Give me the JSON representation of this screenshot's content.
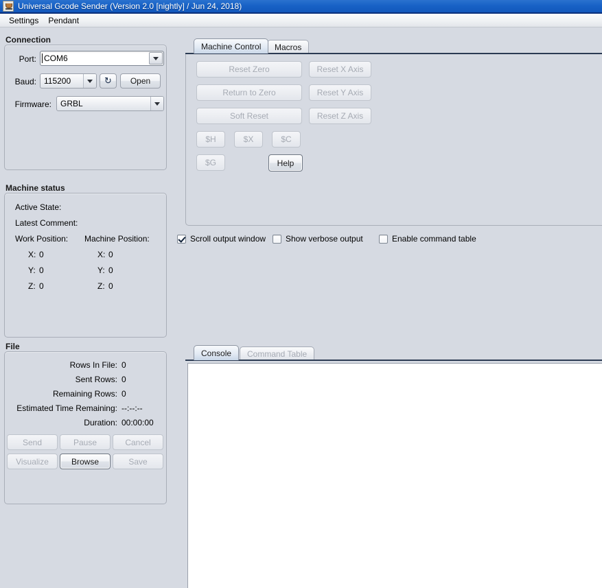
{
  "window": {
    "title": "Universal Gcode Sender (Version 2.0 [nightly]  / Jun 24, 2018)",
    "icon": "java-coffee-cup-icon"
  },
  "menubar": {
    "items": [
      {
        "label": "Settings"
      },
      {
        "label": "Pendant"
      }
    ]
  },
  "connection": {
    "title": "Connection",
    "port_label": "Port:",
    "port_value": "COM6",
    "baud_label": "Baud:",
    "baud_value": "115200",
    "refresh_icon": "refresh-icon",
    "refresh_glyph": "↻",
    "open_label": "Open",
    "firmware_label": "Firmware:",
    "firmware_value": "GRBL"
  },
  "machine_status": {
    "title": "Machine status",
    "active_state_label": "Active State:",
    "active_state_value": "",
    "latest_comment_label": "Latest Comment:",
    "latest_comment_value": "",
    "work_position_label": "Work Position:",
    "machine_position_label": "Machine Position:",
    "work": {
      "x_label": "X:",
      "x": "0",
      "y_label": "Y:",
      "y": "0",
      "z_label": "Z:",
      "z": "0"
    },
    "machine": {
      "x_label": "X:",
      "x": "0",
      "y_label": "Y:",
      "y": "0",
      "z_label": "Z:",
      "z": "0"
    }
  },
  "file": {
    "title": "File",
    "rows_in_file_label": "Rows In File:",
    "rows_in_file_value": "0",
    "sent_rows_label": "Sent Rows:",
    "sent_rows_value": "0",
    "remaining_rows_label": "Remaining Rows:",
    "remaining_rows_value": "0",
    "estimated_time_label": "Estimated Time Remaining:",
    "estimated_time_value": "--:--:--",
    "duration_label": "Duration:",
    "duration_value": "00:00:00",
    "buttons": {
      "send": "Send",
      "pause": "Pause",
      "cancel": "Cancel",
      "visualize": "Visualize",
      "browse": "Browse",
      "save": "Save"
    }
  },
  "control_tabs": {
    "machine_control": "Machine Control",
    "macros": "Macros"
  },
  "machine_control": {
    "reset_zero": "Reset Zero",
    "return_to_zero": "Return to Zero",
    "soft_reset": "Soft Reset",
    "reset_x_axis": "Reset X Axis",
    "reset_y_axis": "Reset Y Axis",
    "reset_z_axis": "Reset Z Axis",
    "cmd_h": "$H",
    "cmd_x": "$X",
    "cmd_c": "$C",
    "cmd_g": "$G",
    "help": "Help"
  },
  "options": {
    "scroll_output_window": "Scroll output window",
    "show_verbose_output": "Show verbose output",
    "enable_command_table": "Enable command table"
  },
  "console_tabs": {
    "console": "Console",
    "command_table": "Command Table"
  },
  "console": {
    "content": ""
  }
}
